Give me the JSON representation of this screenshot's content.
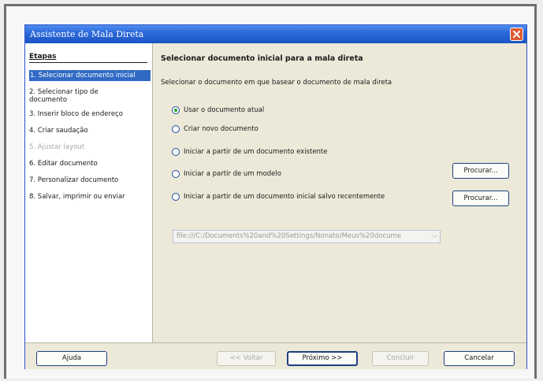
{
  "dialog": {
    "title": "Assistente de Mala Direta"
  },
  "sidebar": {
    "title": "Etapas",
    "steps": [
      {
        "label": "1. Selecionar documento inicial"
      },
      {
        "label": "2. Selecionar tipo de documento"
      },
      {
        "label": "3. Inserir bloco de endereço"
      },
      {
        "label": "4. Criar saudação"
      },
      {
        "label": "5. Ajustar layout"
      },
      {
        "label": "6. Editar documento"
      },
      {
        "label": "7. Personalizar documento"
      },
      {
        "label": "8. Salvar, imprimir ou enviar"
      }
    ]
  },
  "main": {
    "heading": "Selecionar documento inicial para a mala direta",
    "description": "Selecionar o documento em que basear o documento de mala direta",
    "options": [
      {
        "label": "Usar o documento atual",
        "checked": true
      },
      {
        "label": "Criar novo documento",
        "checked": false
      },
      {
        "label": "Iniciar a partir de um documento existente",
        "checked": false
      },
      {
        "label": "Iniciar a partir de um modelo",
        "checked": false
      },
      {
        "label": "Iniciar a partir de um documento inicial salvo recentemente",
        "checked": false
      }
    ],
    "browse_label": "Procurar...",
    "recent_file": "file:///C:/Documents%20and%20Settings/Nonato/Meus%20docume"
  },
  "buttons": {
    "help": "Ajuda",
    "back": "<< Voltar",
    "next": "Próximo >>",
    "finish": "Concluir",
    "cancel": "Cancelar"
  },
  "colors": {
    "titlebar": "#2a67d8",
    "selection": "#316ac5",
    "close": "#e05a32"
  }
}
